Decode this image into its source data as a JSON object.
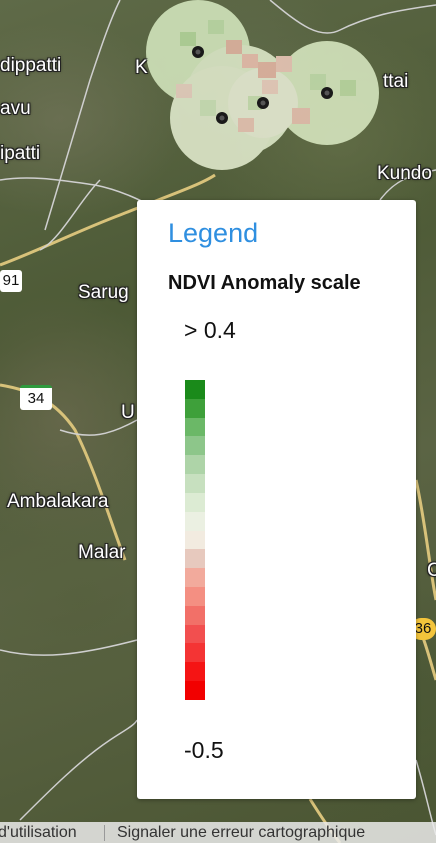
{
  "map": {
    "places": [
      "dippatti",
      "avu",
      "ipatti",
      "K",
      "ttai",
      "Kundo",
      "Sarug",
      "U",
      "Ambalakara",
      "Malar",
      "C"
    ],
    "road_shields": [
      "91",
      "34",
      "36"
    ]
  },
  "legend": {
    "title": "Legend",
    "subtitle": "NDVI Anomaly scale",
    "max_label": "> 0.4",
    "min_label": "-0.5",
    "scale_colors": [
      "#1a8a1a",
      "#3ea03a",
      "#6bb867",
      "#8dc68a",
      "#aed4a8",
      "#c7e0bf",
      "#dcebd3",
      "#ebf0e2",
      "#f2ebe0",
      "#e7c9be",
      "#f2aa9c",
      "#f48f82",
      "#f27068",
      "#f24f4f",
      "#f43434",
      "#f51414",
      "#f20000"
    ]
  },
  "attribution": {
    "terms": "d'utilisation",
    "report": "Signaler une erreur cartographique"
  }
}
